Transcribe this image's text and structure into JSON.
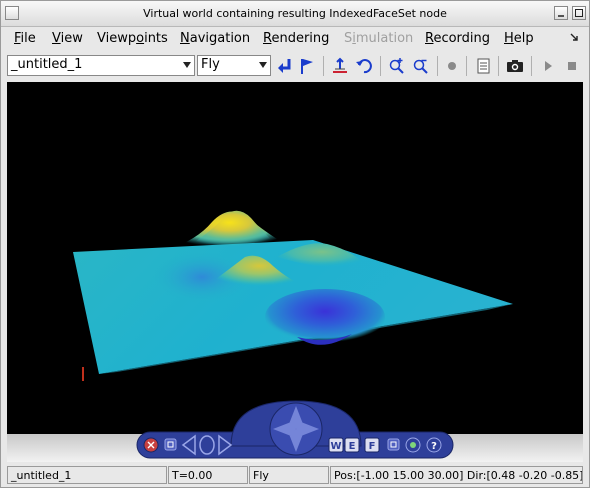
{
  "window": {
    "title": "Virtual world containing resulting IndexedFaceSet node"
  },
  "menu": [
    {
      "label": "File",
      "enabled": true
    },
    {
      "label": "View",
      "enabled": true
    },
    {
      "label": "Viewpoints",
      "enabled": true
    },
    {
      "label": "Navigation",
      "enabled": true
    },
    {
      "label": "Rendering",
      "enabled": true
    },
    {
      "label": "Simulation",
      "enabled": false
    },
    {
      "label": "Recording",
      "enabled": true
    },
    {
      "label": "Help",
      "enabled": true
    }
  ],
  "toolbar": {
    "world_selector_value": "_untitled_1",
    "navigation_mode_value": "Fly",
    "icons": [
      "return-icon",
      "flag-icon",
      "straighten-icon",
      "undo-move-icon",
      "zoom-in-icon",
      "zoom-out-icon",
      "record-icon",
      "file-icon",
      "camera-icon",
      "play-icon",
      "stop-icon"
    ]
  },
  "colors": {
    "viewport_bg": "#000000",
    "surface_high": "#f9e51e",
    "surface_mid": "#22b3c8",
    "surface_low": "#3a3ad6",
    "nav_panel": "#2e3f9a"
  },
  "navpanel": {
    "letter_buttons": [
      "W",
      "E",
      "F"
    ]
  },
  "status": {
    "world": "_untitled_1",
    "time": "T=0.00",
    "mode": "Fly",
    "position": "Pos:[-1.00 15.00 30.00] Dir:[0.48 -0.20 -0.85]"
  }
}
